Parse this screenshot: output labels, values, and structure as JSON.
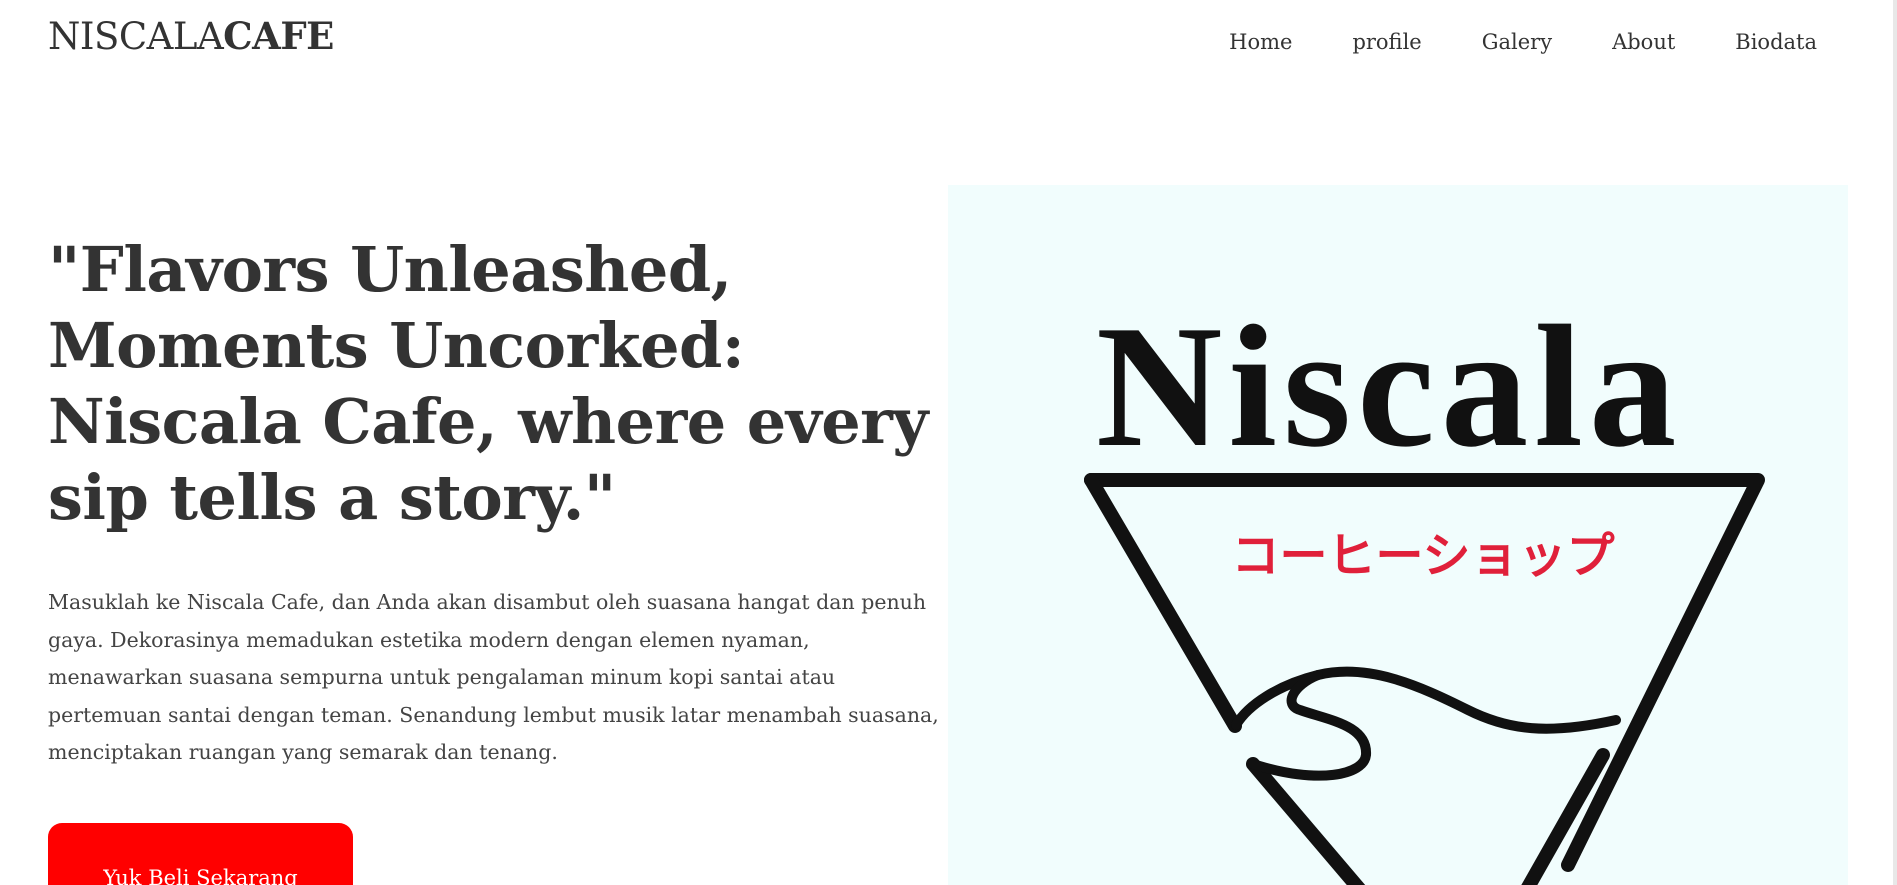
{
  "brand": {
    "light": "NISCALA",
    "bold": "CAFE"
  },
  "nav": {
    "items": [
      "Home",
      "profile",
      "Galery",
      "About",
      "Biodata"
    ]
  },
  "hero": {
    "headline": "\"Flavors Unleashed, Moments Uncorked: Niscala Cafe, where every sip tells a story.\"",
    "description": "Masuklah ke Niscala Cafe, dan Anda akan disambut oleh suasana hangat dan penuh gaya. Dekorasinya memadukan estetika modern dengan elemen nyaman, menawarkan suasana sempurna untuk pengalaman minum kopi santai atau pertemuan santai dengan teman. Senandung lembut musik latar menambah suasana, menciptakan ruangan yang semarak dan tenang.",
    "cta_label": "Yuk Beli Sekarang"
  },
  "logo": {
    "name": "Niscala",
    "subtitle": "コーヒーショップ"
  },
  "colors": {
    "accent": "#ff0000",
    "logo_bg": "#f1fdfd",
    "logo_subtitle": "#e0203a",
    "text": "#333333"
  }
}
